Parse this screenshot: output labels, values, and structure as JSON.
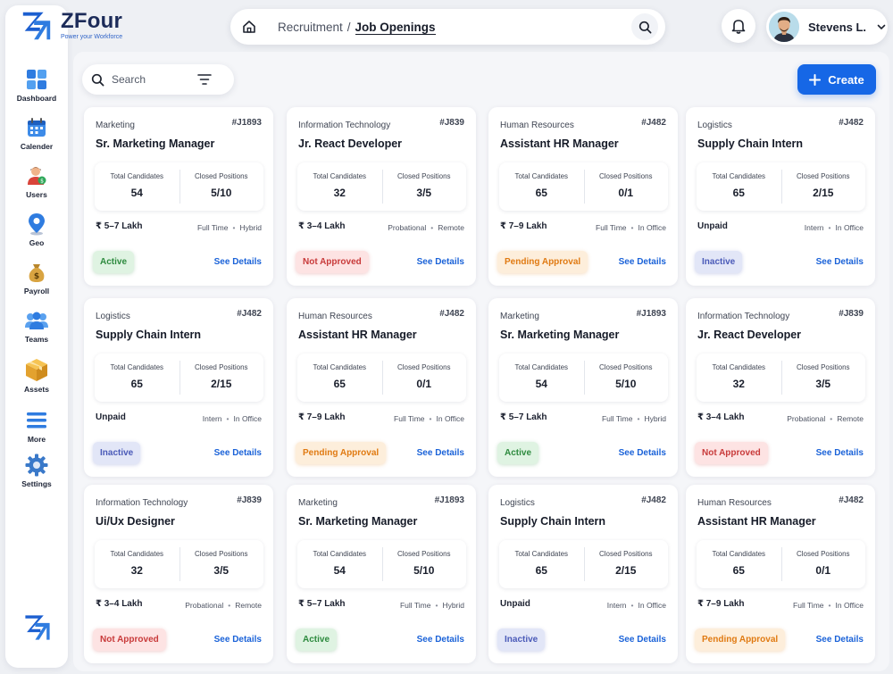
{
  "brand": {
    "name": "ZFour",
    "tagline": "Power your Workforce"
  },
  "sidebar": {
    "items": [
      {
        "label": "Dashboard",
        "icon": "dashboard-icon"
      },
      {
        "label": "Calender",
        "icon": "calendar-icon"
      },
      {
        "label": "Users",
        "icon": "users-icon"
      },
      {
        "label": "Geo",
        "icon": "location-pin-icon"
      },
      {
        "label": "Payroll",
        "icon": "money-bag-icon"
      },
      {
        "label": "Teams",
        "icon": "teams-icon"
      },
      {
        "label": "Assets",
        "icon": "box-icon"
      },
      {
        "label": "More",
        "icon": "menu-icon"
      },
      {
        "label": "Settings",
        "icon": "gear-icon"
      }
    ]
  },
  "header": {
    "breadcrumb": {
      "parent": "Recruitment",
      "separator": "/",
      "current": "Job Openings"
    },
    "user": {
      "name": "Stevens L."
    }
  },
  "toolbar": {
    "search_placeholder": "Search",
    "create_label": "Create"
  },
  "colors": {
    "accent": "#1667e6",
    "active": "#2d8a3e",
    "not_approved": "#c83a3a",
    "pending": "#e07a12",
    "inactive": "#4a5ab8"
  },
  "jobs": [
    {
      "dept": "Marketing",
      "id": "#J1893",
      "title": "Sr. Marketing Manager",
      "cand_label": "Total Candidates",
      "pos_label": "Closed Positions",
      "candidates": "54",
      "positions": "5/10",
      "salary": "₹ 5–7 Lakh",
      "type": "Full Time",
      "mode": "Hybrid",
      "status": "Active",
      "status_key": "active",
      "details": "See Details"
    },
    {
      "dept": "Information Technology",
      "id": "#J839",
      "title": "Jr. React Developer",
      "cand_label": "Total Candidates",
      "pos_label": "Closed Positions",
      "candidates": "32",
      "positions": "3/5",
      "salary": "₹ 3–4 Lakh",
      "type": "Probational",
      "mode": "Remote",
      "status": "Not Approved",
      "status_key": "notapp",
      "details": "See Details"
    },
    {
      "dept": "Human Resources",
      "id": "#J482",
      "title": "Assistant HR Manager",
      "cand_label": "Total Candidates",
      "pos_label": "Closed Positions",
      "candidates": "65",
      "positions": "0/1",
      "salary": "₹ 7–9 Lakh",
      "type": "Full Time",
      "mode": "In Office",
      "status": "Pending Approval",
      "status_key": "pending",
      "details": "See Details"
    },
    {
      "dept": "Logistics",
      "id": "#J482",
      "title": "Supply Chain Intern",
      "cand_label": "Total Candidates",
      "pos_label": "Closed Positions",
      "candidates": "65",
      "positions": "2/15",
      "salary": "Unpaid",
      "type": "Intern",
      "mode": "In Office",
      "status": "Inactive",
      "status_key": "inactive",
      "details": "See Details"
    },
    {
      "dept": "Logistics",
      "id": "#J482",
      "title": "Supply Chain Intern",
      "cand_label": "Total Candidates",
      "pos_label": "Closed Positions",
      "candidates": "65",
      "positions": "2/15",
      "salary": "Unpaid",
      "type": "Intern",
      "mode": "In Office",
      "status": "Inactive",
      "status_key": "inactive",
      "details": "See Details"
    },
    {
      "dept": "Human Resources",
      "id": "#J482",
      "title": "Assistant HR Manager",
      "cand_label": "Total Candidates",
      "pos_label": "Closed Positions",
      "candidates": "65",
      "positions": "0/1",
      "salary": "₹ 7–9 Lakh",
      "type": "Full Time",
      "mode": "In Office",
      "status": "Pending Approval",
      "status_key": "pending",
      "details": "See Details"
    },
    {
      "dept": "Marketing",
      "id": "#J1893",
      "title": "Sr. Marketing Manager",
      "cand_label": "Total Candidates",
      "pos_label": "Closed Positions",
      "candidates": "54",
      "positions": "5/10",
      "salary": "₹ 5–7 Lakh",
      "type": "Full Time",
      "mode": "Hybrid",
      "status": "Active",
      "status_key": "active",
      "details": "See Details"
    },
    {
      "dept": "Information Technology",
      "id": "#J839",
      "title": "Jr. React Developer",
      "cand_label": "Total Candidates",
      "pos_label": "Closed Positions",
      "candidates": "32",
      "positions": "3/5",
      "salary": "₹ 3–4 Lakh",
      "type": "Probational",
      "mode": "Remote",
      "status": "Not Approved",
      "status_key": "notapp",
      "details": "See Details"
    },
    {
      "dept": "Information Technology",
      "id": "#J839",
      "title": "Ui/Ux Designer",
      "cand_label": "Total Candidates",
      "pos_label": "Closed Positions",
      "candidates": "32",
      "positions": "3/5",
      "salary": "₹ 3–4 Lakh",
      "type": "Probational",
      "mode": "Remote",
      "status": "Not Approved",
      "status_key": "notapp",
      "details": "See Details"
    },
    {
      "dept": "Marketing",
      "id": "#J1893",
      "title": "Sr. Marketing Manager",
      "cand_label": "Total Candidates",
      "pos_label": "Closed Positions",
      "candidates": "54",
      "positions": "5/10",
      "salary": "₹ 5–7 Lakh",
      "type": "Full Time",
      "mode": "Hybrid",
      "status": "Active",
      "status_key": "active",
      "details": "See Details"
    },
    {
      "dept": "Logistics",
      "id": "#J482",
      "title": "Supply Chain Intern",
      "cand_label": "Total Candidates",
      "pos_label": "Closed Positions",
      "candidates": "65",
      "positions": "2/15",
      "salary": "Unpaid",
      "type": "Intern",
      "mode": "In Office",
      "status": "Inactive",
      "status_key": "inactive",
      "details": "See Details"
    },
    {
      "dept": "Human Resources",
      "id": "#J482",
      "title": "Assistant HR Manager",
      "cand_label": "Total Candidates",
      "pos_label": "Closed Positions",
      "candidates": "65",
      "positions": "0/1",
      "salary": "₹ 7–9 Lakh",
      "type": "Full Time",
      "mode": "In Office",
      "status": "Pending Approval",
      "status_key": "pending",
      "details": "See Details"
    }
  ]
}
